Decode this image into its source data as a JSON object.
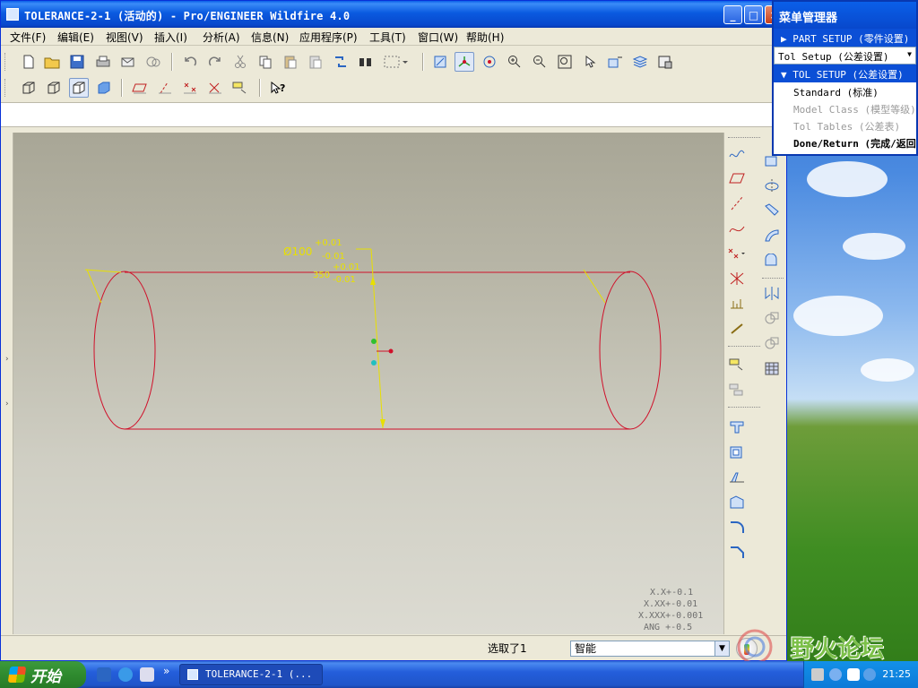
{
  "window": {
    "title": "TOLERANCE-2-1 (活动的) - Pro/ENGINEER Wildfire 4.0",
    "minimize": "_",
    "maximize": "□",
    "close": "×"
  },
  "menubar": [
    "文件(F)",
    "编辑(E)",
    "视图(V)",
    "插入(I)",
    "分析(A)",
    "信息(N)",
    "应用程序(P)",
    "工具(T)",
    "窗口(W)",
    "帮助(H)"
  ],
  "model": {
    "diameter_dim": "Ø100",
    "diameter_tol_upper": "+0.01",
    "diameter_tol_lower": "-0.01",
    "length_dim": "350",
    "length_tol_upper": "+0.01",
    "length_tol_lower": "-0.01",
    "colors": {
      "edges": "#d0102a",
      "dimensions": "#e8e000"
    }
  },
  "tolerance_table": [
    "X.X+-0.1",
    "X.XX+-0.01",
    "X.XXX+-0.001",
    "ANG +-0.5"
  ],
  "status": {
    "selected": "选取了1",
    "filter_value": "智能"
  },
  "menu_manager": {
    "title": "菜单管理器",
    "part_setup": "PART SETUP (零件设置)",
    "tol_setup_select": "Tol Setup (公差设置)",
    "tol_setup_header": "TOL SETUP (公差设置)",
    "items": [
      {
        "label": "Standard (标准)",
        "enabled": true
      },
      {
        "label": "Model Class (模型等级)",
        "enabled": false
      },
      {
        "label": "Tol Tables (公差表)",
        "enabled": false
      },
      {
        "label": "Done/Return (完成/返回)",
        "enabled": true,
        "bold": true
      }
    ]
  },
  "taskbar": {
    "start": "开始",
    "task_button": "TOLERANCE-2-1 (...",
    "clock": "21:25",
    "overflow": "»"
  },
  "watermark": "野火论坛"
}
